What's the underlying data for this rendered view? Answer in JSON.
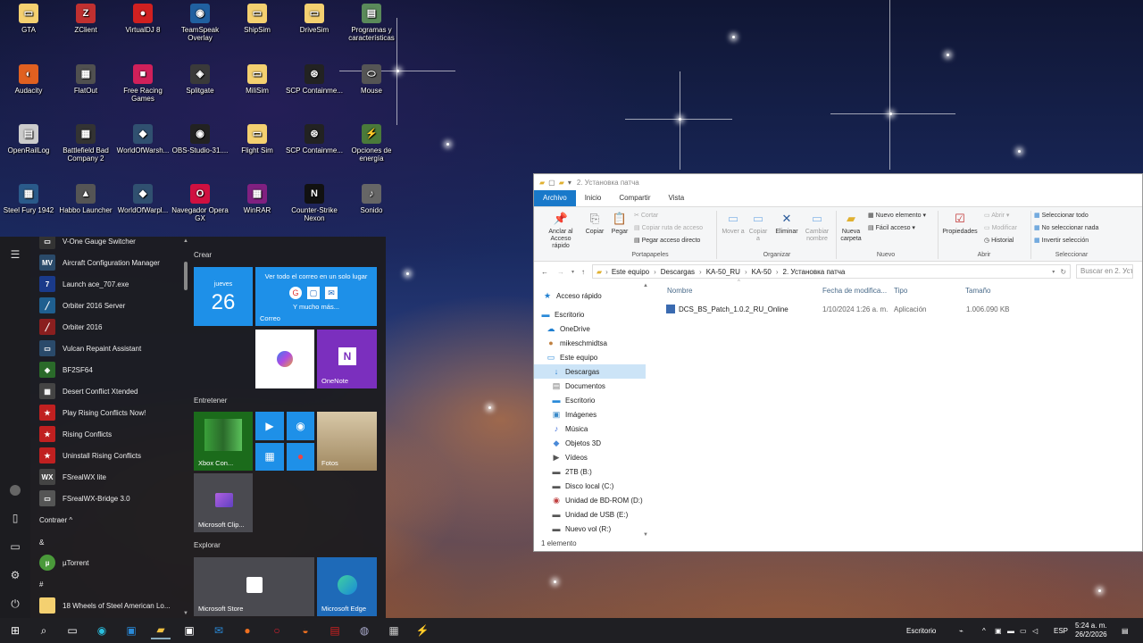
{
  "desktop_icons": [
    {
      "label": "GTA",
      "color": "#f4d070",
      "glyph": "▭"
    },
    {
      "label": "ZClient",
      "color": "#c03030",
      "glyph": "Z"
    },
    {
      "label": "VirtualDJ 8",
      "color": "#d02020",
      "glyph": "●"
    },
    {
      "label": "TeamSpeak Overlay",
      "color": "#2060a0",
      "glyph": "◉"
    },
    {
      "label": "ShipSim",
      "color": "#f4d070",
      "glyph": "▭"
    },
    {
      "label": "DriveSim",
      "color": "#f4d070",
      "glyph": "▭"
    },
    {
      "label": "Programas y características",
      "color": "#5a8a5a",
      "glyph": "▤"
    },
    {
      "label": "Audacity",
      "color": "#e06020",
      "glyph": "◐"
    },
    {
      "label": "FlatOut",
      "color": "#505050",
      "glyph": "▦"
    },
    {
      "label": "Free Racing Games",
      "color": "#d0205a",
      "glyph": "■"
    },
    {
      "label": "Splitgate",
      "color": "#3a3a3a",
      "glyph": "◈"
    },
    {
      "label": "MiliSim",
      "color": "#f4d070",
      "glyph": "▭"
    },
    {
      "label": "SCP Containme...",
      "color": "#222",
      "glyph": "⊛"
    },
    {
      "label": "Mouse",
      "color": "#555",
      "glyph": "⬭"
    },
    {
      "label": "OpenRailLog",
      "color": "#cccccc",
      "glyph": "▤"
    },
    {
      "label": "Battlefield Bad Company 2",
      "color": "#333",
      "glyph": "▦"
    },
    {
      "label": "WorldOfWarsh...",
      "color": "#305070",
      "glyph": "◆"
    },
    {
      "label": "OBS-Studio-31....",
      "color": "#222",
      "glyph": "◉"
    },
    {
      "label": "Flight Sim",
      "color": "#f4d070",
      "glyph": "▭"
    },
    {
      "label": "SCP Containme...",
      "color": "#222",
      "glyph": "⊛"
    },
    {
      "label": "Opciones de energía",
      "color": "#4a7a3a",
      "glyph": "⚡"
    },
    {
      "label": "Steel Fury 1942",
      "color": "#2a5a8a",
      "glyph": "▦"
    },
    {
      "label": "Habbo Launcher",
      "color": "#555",
      "glyph": "▲"
    },
    {
      "label": "WorldOfWarpl...",
      "color": "#305070",
      "glyph": "◆"
    },
    {
      "label": "Navegador Opera GX",
      "color": "#d01040",
      "glyph": "O"
    },
    {
      "label": "WinRAR",
      "color": "#802080",
      "glyph": "▦"
    },
    {
      "label": "Counter-Strike Nexon",
      "color": "#111",
      "glyph": "N"
    },
    {
      "label": "Sonido",
      "color": "#666",
      "glyph": "♪"
    }
  ],
  "start_menu": {
    "apps": [
      {
        "label": "V-One Gauge Switcher",
        "color": "#333",
        "glyph": "▭"
      },
      {
        "label": "Aircraft Configuration Manager",
        "color": "#2a4a6a",
        "glyph": "MV"
      },
      {
        "label": "Launch ace_707.exe",
        "color": "#1a3a8a",
        "glyph": "7"
      },
      {
        "label": "Orbiter 2016 Server",
        "color": "#1f5f8f",
        "glyph": "╱"
      },
      {
        "label": "Orbiter 2016",
        "color": "#8a1f1f",
        "glyph": "╱"
      },
      {
        "label": "Vulcan Repaint Assistant",
        "color": "#2a4a6a",
        "glyph": "▭"
      },
      {
        "label": "BF2SF64",
        "color": "#2a6a2a",
        "glyph": "◈"
      },
      {
        "label": "Desert Conflict Xtended",
        "color": "#444",
        "glyph": "▦"
      },
      {
        "label": "Play Rising Conflicts Now!",
        "color": "#c02020",
        "glyph": "★"
      },
      {
        "label": "Rising Conflicts",
        "color": "#c02020",
        "glyph": "★"
      },
      {
        "label": "Uninstall Rising Conflicts",
        "color": "#c02020",
        "glyph": "★"
      },
      {
        "label": "FSrealWX lite",
        "color": "#444",
        "glyph": "WX"
      },
      {
        "label": "FSrealWX-Bridge 3.0",
        "color": "#555",
        "glyph": "▭"
      }
    ],
    "collapse_label": "Contraer ^",
    "section_amp": "&",
    "utorrent": "µTorrent",
    "section_hash": "#",
    "wheels": "18 Wheels of Steel American Lo...",
    "tile_groups": {
      "crear": "Crear",
      "entretener": "Entretener",
      "explorar": "Explorar"
    },
    "calendar": {
      "day": "jueves",
      "date": "26"
    },
    "mail": {
      "headline": "Ver todo el correo en un solo lugar",
      "more": "Y mucho más...",
      "label": "Correo"
    },
    "onenote": "OneNote",
    "xbox": "Xbox Con...",
    "fotos": "Fotos",
    "clipchamp": "Microsoft Clip...",
    "store": "Microsoft Store",
    "edge": "Microsoft Edge"
  },
  "explorer": {
    "title": "2. Установка патча",
    "tabs": [
      "Archivo",
      "Inicio",
      "Compartir",
      "Vista"
    ],
    "ribbon": {
      "pin": "Anclar al Acceso rápido",
      "copy": "Copiar",
      "paste": "Pegar",
      "cut": "Cortar",
      "copy_path": "Copiar ruta de acceso",
      "paste_shortcut": "Pegar acceso directo",
      "move": "Mover a",
      "copy_to": "Copiar a",
      "delete": "Eliminar",
      "rename": "Cambiar nombre",
      "new_folder": "Nueva carpeta",
      "new_item": "Nuevo elemento",
      "easy_access": "Fácil acceso",
      "properties": "Propiedades",
      "open": "Abrir",
      "modify": "Modificar",
      "history": "Historial",
      "select_all": "Seleccionar todo",
      "select_none": "No seleccionar nada",
      "invert": "Invertir selección",
      "groups": [
        "Portapapeles",
        "Organizar",
        "Nuevo",
        "Abrir",
        "Seleccionar"
      ]
    },
    "breadcrumb": [
      "Este equipo",
      "Descargas",
      "KA-50_RU",
      "KA-50",
      "2. Установка патча"
    ],
    "search_placeholder": "Buscar en 2. Уст...",
    "nav": [
      {
        "label": "Acceso rápido",
        "icon": "★",
        "color": "#1f7fd0"
      },
      {
        "label": "Escritorio",
        "icon": "▬",
        "color": "#2a8ad8"
      },
      {
        "label": "OneDrive",
        "icon": "☁",
        "color": "#1f7fd0"
      },
      {
        "label": "mikeschmidtsa",
        "icon": "●",
        "color": "#c08040"
      },
      {
        "label": "Este equipo",
        "icon": "▭",
        "color": "#2a8ad8"
      },
      {
        "label": "Descargas",
        "icon": "↓",
        "color": "#2a7fd0"
      },
      {
        "label": "Documentos",
        "icon": "▤",
        "color": "#777"
      },
      {
        "label": "Escritorio",
        "icon": "▬",
        "color": "#2a8ad8"
      },
      {
        "label": "Imágenes",
        "icon": "▣",
        "color": "#3a8ac8"
      },
      {
        "label": "Música",
        "icon": "♪",
        "color": "#3a6ad8"
      },
      {
        "label": "Objetos 3D",
        "icon": "◆",
        "color": "#4a8ad8"
      },
      {
        "label": "Vídeos",
        "icon": "▶",
        "color": "#555"
      },
      {
        "label": "2TB (B:)",
        "icon": "▬",
        "color": "#555"
      },
      {
        "label": "Disco local (C:)",
        "icon": "▬",
        "color": "#555"
      },
      {
        "label": "Unidad de BD-ROM (D:)",
        "icon": "◉",
        "color": "#c04040"
      },
      {
        "label": "Unidad de USB (E:)",
        "icon": "▬",
        "color": "#555"
      },
      {
        "label": "Nuevo vol (R:)",
        "icon": "▬",
        "color": "#555"
      }
    ],
    "columns": [
      "Nombre",
      "Fecha de modifica...",
      "Tipo",
      "Tamaño"
    ],
    "files": [
      {
        "name": "DCS_BS_Patch_1.0.2_RU_Online",
        "date": "1/10/2024 1:26 a. m.",
        "type": "Aplicación",
        "size": "1.006.090 KB"
      }
    ],
    "status": "1 elemento"
  },
  "taskbar": {
    "escritorio": "Escritorio",
    "lang": "ESP",
    "time": "5:24 a. m.",
    "date": "26/2/2026"
  }
}
